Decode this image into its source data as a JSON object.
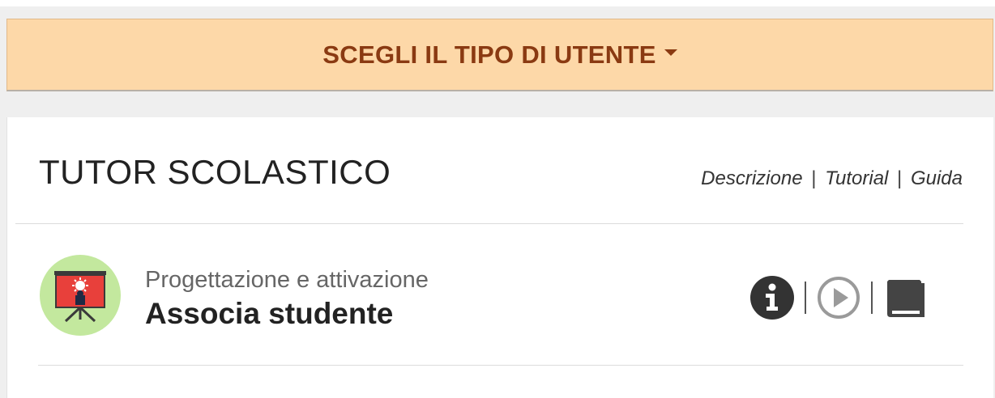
{
  "user_type_selector": {
    "label": "SCEGLI IL TIPO DI UTENTE",
    "icon": "caret-down-icon"
  },
  "section": {
    "title": "TUTOR SCOLASTICO",
    "links": [
      {
        "label": "Descrizione"
      },
      {
        "label": "Tutorial"
      },
      {
        "label": "Guida"
      }
    ],
    "link_separator": "|"
  },
  "feature": {
    "icon": "presentation-board-icon",
    "subtitle": "Progettazione e attivazione",
    "title": "Associa studente",
    "actions": [
      {
        "icon": "info-icon"
      },
      {
        "icon": "play-icon"
      },
      {
        "icon": "book-icon"
      }
    ]
  },
  "colors": {
    "selector_background": "#fdd8a8",
    "selector_text": "#8a3a12",
    "icon_circle": "#c3e89e",
    "board_red": "#e8403b"
  }
}
